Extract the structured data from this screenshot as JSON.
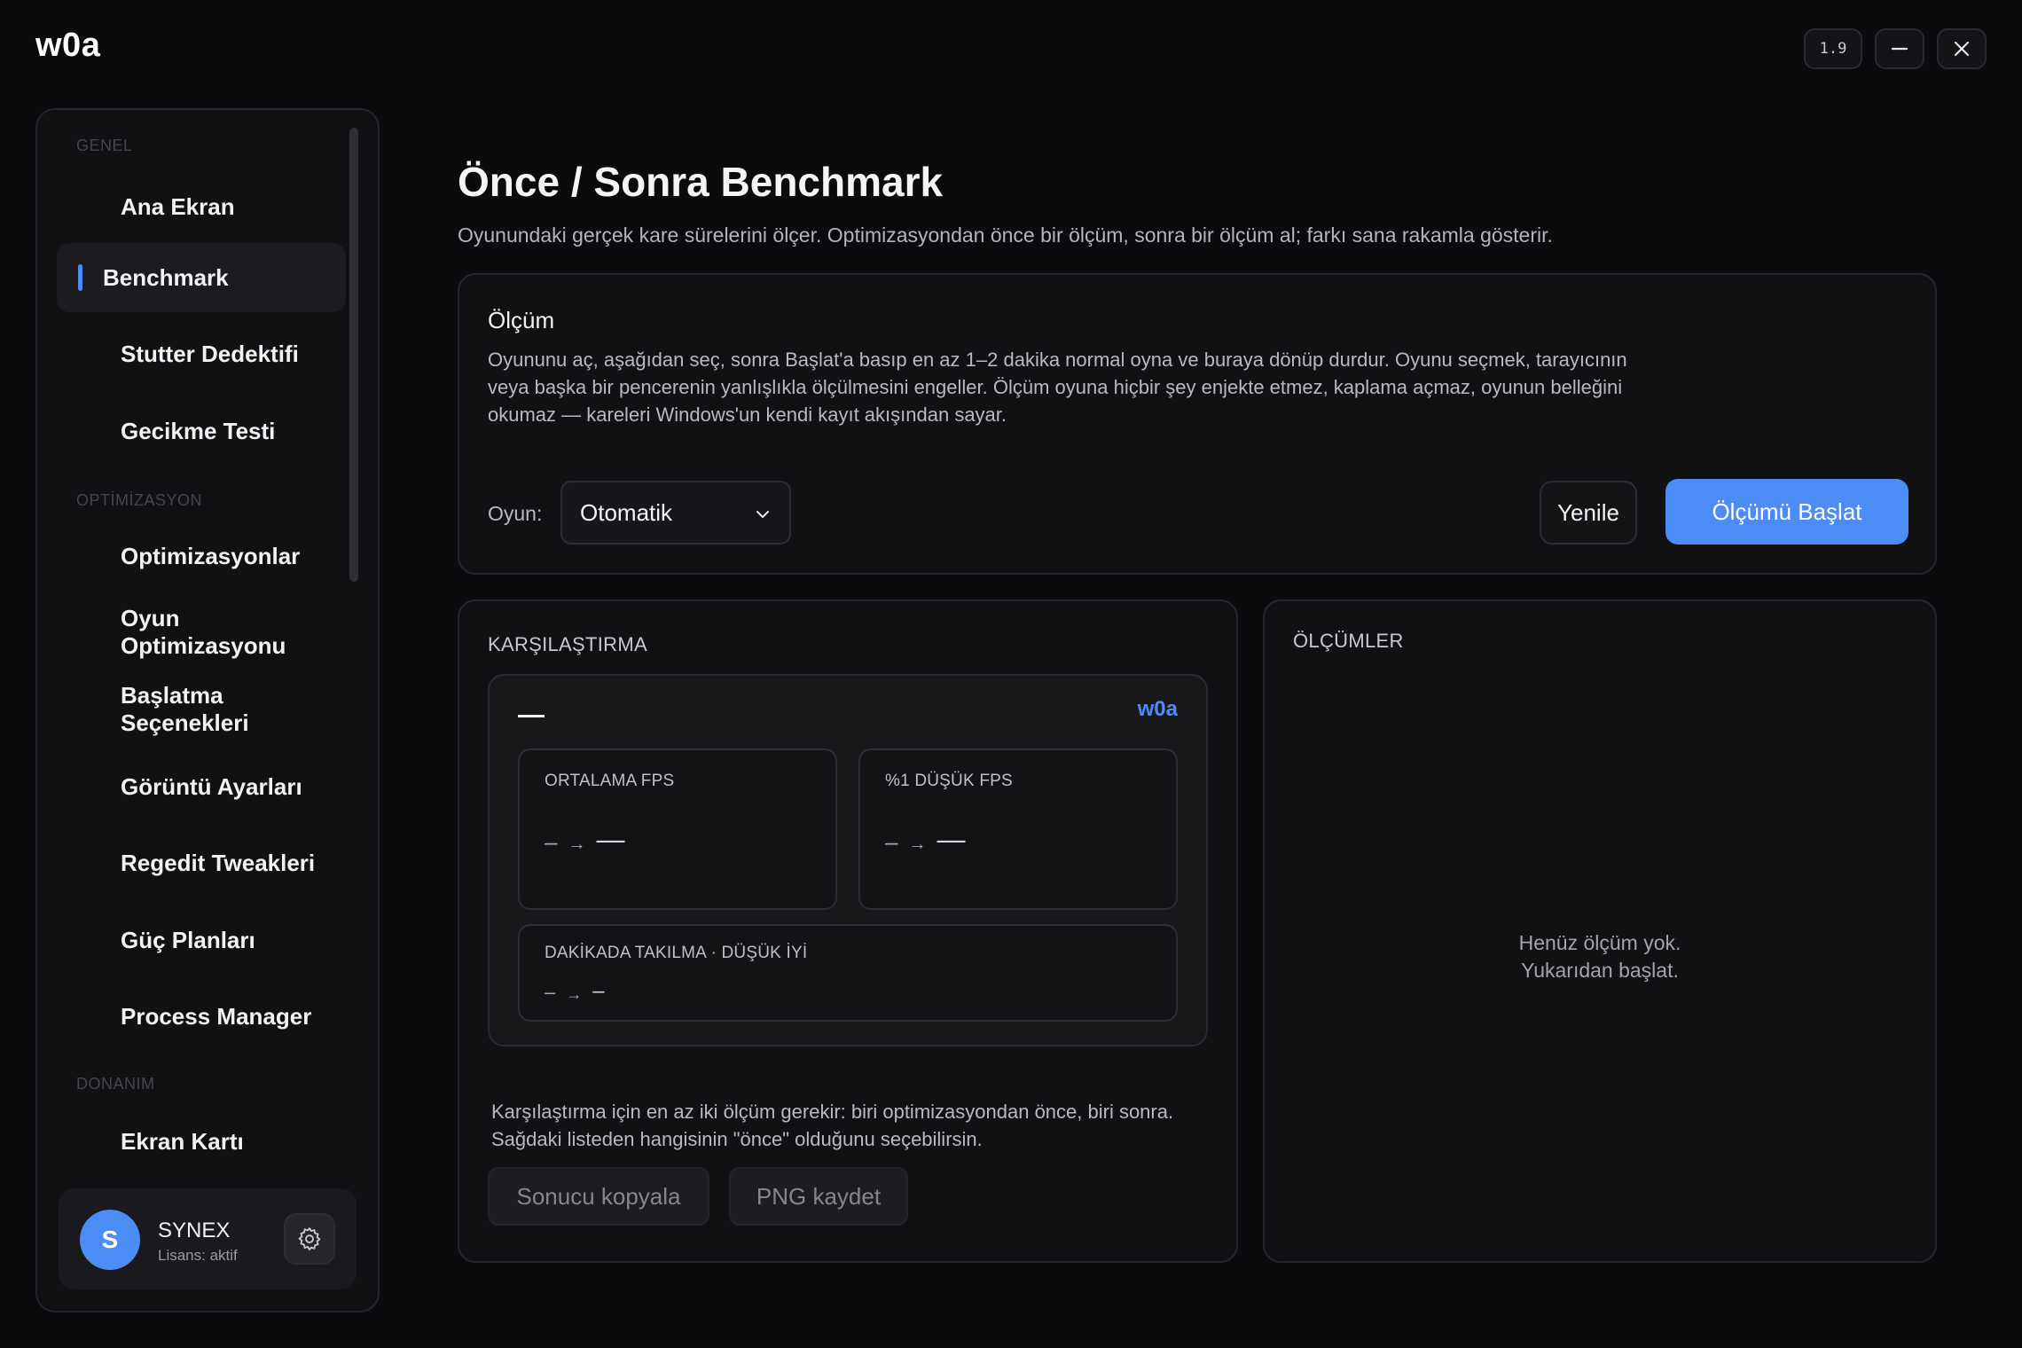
{
  "app": {
    "logo": "w0a",
    "version": "1.9"
  },
  "sidebar": {
    "sections": [
      {
        "label": "GENEL"
      },
      {
        "label": "OPTİMİZASYON"
      },
      {
        "label": "DONANIM"
      }
    ],
    "items": [
      {
        "label": "Ana Ekran"
      },
      {
        "label": "Benchmark",
        "active": true
      },
      {
        "label": "Stutter Dedektifi"
      },
      {
        "label": "Gecikme Testi"
      },
      {
        "label": "Optimizasyonlar"
      },
      {
        "label": "Oyun Optimizasyonu"
      },
      {
        "label": "Başlatma Seçenekleri"
      },
      {
        "label": "Görüntü Ayarları"
      },
      {
        "label": "Regedit Tweakleri"
      },
      {
        "label": "Güç Planları"
      },
      {
        "label": "Process Manager"
      },
      {
        "label": "Ekran Kartı"
      }
    ],
    "user": {
      "initial": "S",
      "name": "SYNEX",
      "status": "Lisans: aktif"
    }
  },
  "page": {
    "title": "Önce / Sonra Benchmark",
    "subtitle": "Oyunundaki gerçek kare sürelerini ölçer. Optimizasyondan önce bir ölçüm, sonra bir ölçüm al; farkı sana rakamla gösterir."
  },
  "measure": {
    "heading": "Ölçüm",
    "description": "Oyununu aç, aşağıdan seç, sonra Başlat'a basıp en az 1–2 dakika normal oyna ve buraya dönüp durdur. Oyunu seçmek, tarayıcının veya başka bir pencerenin yanlışlıkla ölçülmesini engeller. Ölçüm oyuna hiçbir şey enjekte etmez, kaplama açmaz, oyunun belleğini okumaz — kareleri Windows'un kendi kayıt akışından sayar.",
    "game_label": "Oyun:",
    "game_value": "Otomatik",
    "refresh_label": "Yenile",
    "start_label": "Ölçümü Başlat"
  },
  "compare": {
    "heading": "KARŞILAŞTIRMA",
    "brand": "w0a",
    "stats": [
      {
        "label": "ORTALAMA FPS",
        "before": "–",
        "arrow": "→",
        "after": "—"
      },
      {
        "label": "%1 DÜŞÜK FPS",
        "before": "–",
        "arrow": "→",
        "after": "—"
      },
      {
        "label": "DAKİKADA TAKILMA · DÜŞÜK İYİ",
        "before": "–",
        "arrow": "→",
        "after": "–"
      }
    ],
    "note": "Karşılaştırma için en az iki ölçüm gerekir: biri optimizasyondan önce, biri sonra. Sağdaki listeden hangisinin \"önce\" olduğunu seçebilirsin.",
    "copy_label": "Sonucu kopyala",
    "png_label": "PNG kaydet"
  },
  "results": {
    "heading": "ÖLÇÜMLER",
    "empty_line1": "Henüz ölçüm yok.",
    "empty_line2": "Yukarıdan başlat."
  },
  "colors": {
    "accent": "#4b8cf5",
    "background": "#0b0b0d",
    "card": "#111114"
  }
}
